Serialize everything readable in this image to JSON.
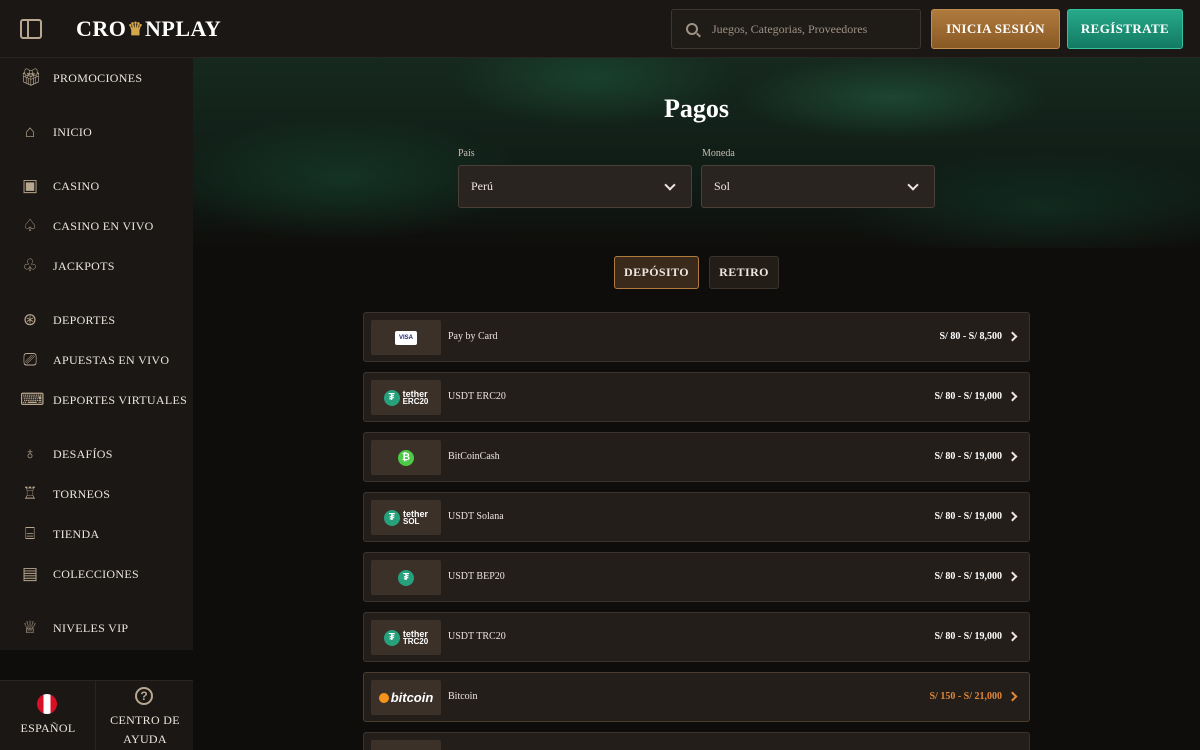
{
  "header": {
    "logo": "CROWNPLAY",
    "logo_left": "CRO",
    "logo_right": "NPLAY",
    "search_placeholder": "Juegos, Categorias, Proveedores",
    "login_label": "INICIA SESIÓN",
    "register_label": "REGÍSTRATE"
  },
  "sidebar": {
    "items": [
      {
        "label": "PROMOCIONES",
        "icon": "gift-icon"
      },
      {
        "label": "INICIO",
        "icon": "home-icon"
      },
      {
        "label": "CASINO",
        "icon": "slot-machine-icon"
      },
      {
        "label": "CASINO EN VIVO",
        "icon": "spade-icon"
      },
      {
        "label": "JACKPOTS",
        "icon": "clover-icon"
      },
      {
        "label": "DEPORTES",
        "icon": "ball-icon"
      },
      {
        "label": "APUESTAS EN VIVO",
        "icon": "live-camera-icon"
      },
      {
        "label": "DEPORTES VIRTUALES",
        "icon": "gamepad-icon"
      },
      {
        "label": "DESAFÍOS",
        "icon": "badge-icon"
      },
      {
        "label": "TORNEOS",
        "icon": "trophy-icon"
      },
      {
        "label": "TIENDA",
        "icon": "store-icon"
      },
      {
        "label": "COLECCIONES",
        "icon": "cards-icon"
      },
      {
        "label": "NIVELES VIP",
        "icon": "crown-icon"
      }
    ],
    "language_label": "ESPAÑOL",
    "help_label": "CENTRO DE AYUDA"
  },
  "main": {
    "title": "Pagos",
    "country_label": "País",
    "country_value": "Perú",
    "currency_label": "Moneda",
    "currency_value": "Sol",
    "tabs": [
      {
        "label": "DEPÓSITO",
        "active": true
      },
      {
        "label": "RETIRO",
        "active": false
      }
    ],
    "methods": [
      {
        "name": "Pay by Card",
        "limits": "S/ 80 - S/ 8,500",
        "logo": "VISA"
      },
      {
        "name": "USDT ERC20",
        "limits": "S/ 80 - S/ 19,000",
        "logo": "tether ERC20"
      },
      {
        "name": "BitCoinCash",
        "limits": "S/ 80 - S/ 19,000",
        "logo": "bitcoin-cash"
      },
      {
        "name": "USDT Solana",
        "limits": "S/ 80 - S/ 19,000",
        "logo": "tether SOL"
      },
      {
        "name": "USDT BEP20",
        "limits": "S/ 80 - S/ 19,000",
        "logo": "tether BEP20"
      },
      {
        "name": "USDT TRC20",
        "limits": "S/ 80 - S/ 19,000",
        "logo": "tether TRC20"
      },
      {
        "name": "Bitcoin",
        "limits": "S/ 150 - S/ 21,000",
        "logo": "bitcoin"
      }
    ]
  },
  "colors": {
    "accent_gold": "#b07a3d",
    "accent_green": "#27a98a",
    "highlight_orange": "#e0873a"
  }
}
